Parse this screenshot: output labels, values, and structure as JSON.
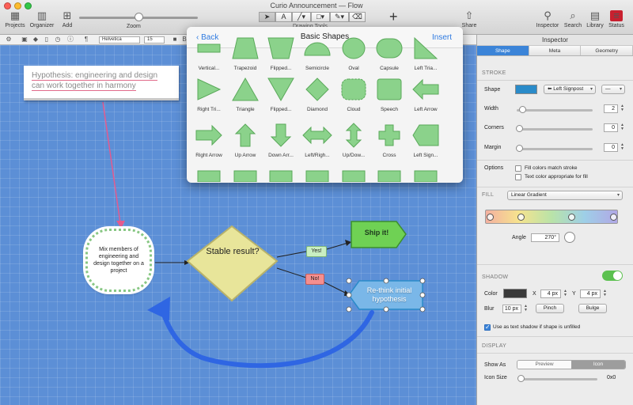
{
  "window": {
    "title": "Curio Announcement — Flow"
  },
  "toolbar": {
    "projects": "Projects",
    "organizer": "Organizer",
    "add": "Add",
    "zoom": "Zoom",
    "drawing_tools": "Drawing Tools",
    "share": "Share",
    "inspector": "Inspector",
    "search": "Search",
    "library": "Library",
    "status": "Status"
  },
  "format_bar": {
    "font": "Helvetica",
    "size": "15"
  },
  "canvas": {
    "note": "Hypothesis: engineering and design can work together in harmony",
    "cloud": "Mix members of engineering and design together on a project",
    "decision": "Stable result?",
    "yes": "Yes!",
    "no": "No!",
    "ship": "Ship it!",
    "rethink": "Re-think initial hypothesis"
  },
  "popover": {
    "back": "Back",
    "title": "Basic Shapes",
    "insert": "Insert",
    "shapes": [
      "Vertical...",
      "Trapezoid",
      "Flipped...",
      "Semicircle",
      "Oval",
      "Capsule",
      "Left Tria...",
      "Right Tri...",
      "Triangle",
      "Flipped...",
      "Diamond",
      "Cloud",
      "Speech",
      "Left Arrow",
      "Right Arrow",
      "Up Arrow",
      "Down Arr...",
      "Left/Righ...",
      "Up/Dow...",
      "Cross",
      "Left Sign..."
    ]
  },
  "inspector": {
    "title": "Inspector",
    "tabs": [
      "Shape",
      "Meta",
      "Geometry"
    ],
    "stroke": {
      "heading": "STROKE",
      "shape_label": "Shape",
      "shape_value": "Left Signpost",
      "width_label": "Width",
      "width_value": "2",
      "corners_label": "Corners",
      "corners_value": "0",
      "margin_label": "Margin",
      "margin_value": "0",
      "options_label": "Options",
      "opt1": "Fill colors match stroke",
      "opt2": "Text color appropriate for fill",
      "color": "#2a8bc9"
    },
    "fill": {
      "heading": "FILL",
      "type": "Linear Gradient",
      "angle_label": "Angle",
      "angle_value": "270°"
    },
    "shadow": {
      "heading": "SHADOW",
      "color_label": "Color",
      "x_label": "X",
      "x_value": "4 px",
      "y_label": "Y",
      "y_value": "4 px",
      "blur_label": "Blur",
      "blur_value": "10 px",
      "pinch": "Pinch",
      "bulge": "Bulge",
      "text_shadow": "Use as text shadow if shape is unfilled"
    },
    "display": {
      "heading": "DISPLAY",
      "show_as_label": "Show As",
      "preview": "Preview",
      "icon": "Icon",
      "icon_size_label": "Icon Size",
      "icon_size_value": "0x0"
    }
  },
  "colors": {
    "accent": "#3b84d8",
    "canvas": "#5c8fd6",
    "ship_fill": "#6fd154",
    "cloud_border": "#88c784"
  }
}
